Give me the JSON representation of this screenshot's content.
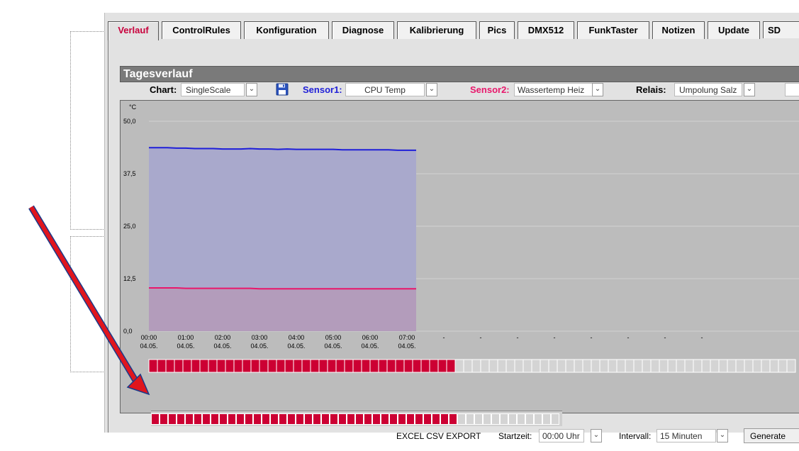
{
  "tabs": [
    {
      "label": "Verlauf",
      "active": true
    },
    {
      "label": "ControlRules",
      "active": false
    },
    {
      "label": "Konfiguration",
      "active": false
    },
    {
      "label": "Diagnose",
      "active": false
    },
    {
      "label": "Kalibrierung",
      "active": false
    },
    {
      "label": "Pics",
      "active": false
    },
    {
      "label": "DMX512",
      "active": false
    },
    {
      "label": "FunkTaster",
      "active": false
    },
    {
      "label": "Notizen",
      "active": false
    },
    {
      "label": "Update",
      "active": false
    },
    {
      "label": "SD",
      "active": false
    }
  ],
  "section_title": "Tagesverlauf",
  "controls": {
    "chart_label": "Chart:",
    "chart_value": "SingleScale",
    "sensor1_label": "Sensor1:",
    "sensor1_value": "CPU Temp",
    "sensor2_label": "Sensor2:",
    "sensor2_value": "Wassertemp Heiz",
    "relais_label": "Relais:",
    "relais_value": "Umpolung Salz",
    "save_icon": "floppy-disk-icon",
    "dropdown_icon": "chevron-down-icon"
  },
  "chart_data": {
    "type": "area",
    "ylabel": "°C",
    "ylim": [
      0,
      50
    ],
    "yticks": [
      "0,0",
      "12,5",
      "25,0",
      "37,5",
      "50,0"
    ],
    "x": [
      "00:00",
      "00:15",
      "00:30",
      "00:45",
      "01:00",
      "01:15",
      "01:30",
      "01:45",
      "02:00",
      "02:15",
      "02:30",
      "02:45",
      "03:00",
      "03:15",
      "03:30",
      "03:45",
      "04:00",
      "04:15",
      "04:30",
      "04:45",
      "05:00",
      "05:15",
      "05:30",
      "05:45",
      "06:00",
      "06:15",
      "06:30",
      "06:45",
      "07:00",
      "07:15"
    ],
    "xticks": [
      {
        "time": "00:00",
        "date": "04.05."
      },
      {
        "time": "01:00",
        "date": "04.05."
      },
      {
        "time": "02:00",
        "date": "04.05."
      },
      {
        "time": "03:00",
        "date": "04.05."
      },
      {
        "time": "04:00",
        "date": "04.05."
      },
      {
        "time": "05:00",
        "date": "04.05."
      },
      {
        "time": "06:00",
        "date": "04.05."
      },
      {
        "time": "07:00",
        "date": "04.05."
      },
      {
        "time": "-",
        "date": ""
      },
      {
        "time": "-",
        "date": ""
      },
      {
        "time": "-",
        "date": ""
      },
      {
        "time": "-",
        "date": ""
      },
      {
        "time": "-",
        "date": ""
      },
      {
        "time": "-",
        "date": ""
      },
      {
        "time": "-",
        "date": ""
      },
      {
        "time": "-",
        "date": ""
      }
    ],
    "series": [
      {
        "name": "CPU Temp",
        "color": "#1f1fd8",
        "fill": "#a9a9cc",
        "values": [
          43.7,
          43.7,
          43.7,
          43.6,
          43.6,
          43.5,
          43.5,
          43.5,
          43.4,
          43.4,
          43.4,
          43.5,
          43.4,
          43.4,
          43.3,
          43.4,
          43.3,
          43.3,
          43.3,
          43.3,
          43.3,
          43.2,
          43.2,
          43.2,
          43.2,
          43.2,
          43.2,
          43.1,
          43.1,
          43.1
        ]
      },
      {
        "name": "Wassertemp Heiz",
        "color": "#e8176b",
        "fill": "#b39cbb",
        "values": [
          10.3,
          10.3,
          10.3,
          10.3,
          10.2,
          10.2,
          10.2,
          10.2,
          10.2,
          10.2,
          10.2,
          10.2,
          10.1,
          10.1,
          10.1,
          10.1,
          10.1,
          10.1,
          10.1,
          10.1,
          10.1,
          10.1,
          10.1,
          10.1,
          10.1,
          10.1,
          10.1,
          10.1,
          10.1,
          10.1
        ]
      }
    ],
    "grid": true,
    "relay_bar_1": {
      "total": 96,
      "active": 36,
      "active_color": "#cc0033"
    },
    "relay_bar_2": {
      "total": 48,
      "active": 36,
      "active_color": "#cc0033"
    }
  },
  "export": {
    "label": "EXCEL CSV EXPORT",
    "startzeit_label": "Startzeit:",
    "startzeit_value": "00:00 Uhr",
    "intervall_label": "Intervall:",
    "intervall_value": "15 Minuten",
    "generate_label": "Generate"
  },
  "annotation": {
    "arrow_color": "#e0151d"
  }
}
